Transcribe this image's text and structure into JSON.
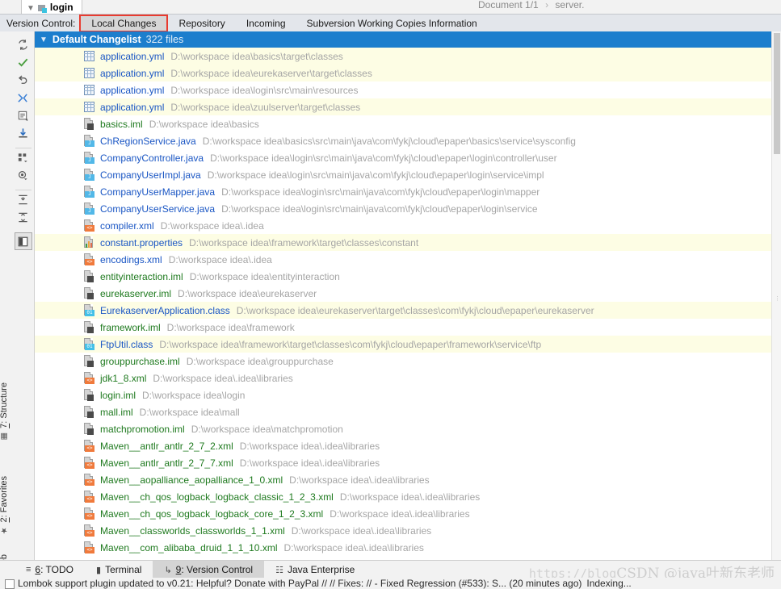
{
  "editor": {
    "tab_label": "login",
    "breadcrumb_document": "Document 1/1",
    "breadcrumb_sep": "›",
    "breadcrumb_node": "server."
  },
  "vcs_toolbar": {
    "label": "Version Control:",
    "tabs": [
      {
        "label": "Local Changes",
        "selected": true
      },
      {
        "label": "Repository",
        "selected": false
      },
      {
        "label": "Incoming",
        "selected": false
      },
      {
        "label": "Subversion Working Copies Information",
        "selected": false
      }
    ],
    "selected_outline_color": "#e83b2f"
  },
  "left_tool_labels": [
    {
      "label_prefix": "7",
      "label": ": Structure",
      "icon": "structure-icon"
    },
    {
      "label_prefix": "2",
      "label": ": Favorites",
      "icon": "star-icon"
    },
    {
      "label_prefix": "",
      "label": "Web",
      "icon": "globe-icon"
    }
  ],
  "action_buttons": [
    {
      "name": "refresh-icon",
      "tooltip": "Refresh"
    },
    {
      "name": "commit-checkmark-icon",
      "tooltip": "Commit"
    },
    {
      "name": "revert-arrow-icon",
      "tooltip": "Revert"
    },
    {
      "name": "collapse-arrows-icon",
      "tooltip": "Shelve Silently"
    },
    {
      "name": "changelist-notes-icon",
      "tooltip": "Edit Changelist"
    },
    {
      "name": "download-update-icon",
      "tooltip": "Update"
    },
    {
      "name": "group-by-icon",
      "tooltip": "Group By"
    },
    {
      "name": "eye-preview-icon",
      "tooltip": "Preview Diff"
    },
    {
      "name": "expand-all-icon",
      "tooltip": "Expand All"
    },
    {
      "name": "collapse-all-icon",
      "tooltip": "Collapse All"
    },
    {
      "name": "toggle-panel-icon",
      "tooltip": "Show Diff Preview"
    }
  ],
  "changelist": {
    "name": "Default Changelist",
    "count_label": "322 files",
    "header_bg": "#1c7ecd",
    "expanded": true
  },
  "files": [
    {
      "name": "application.yml",
      "path": "D:\\workspace idea\\basics\\target\\classes",
      "icon": "yml-file-icon",
      "color": "#1a56c4",
      "alt": true
    },
    {
      "name": "application.yml",
      "path": "D:\\workspace idea\\eurekaserver\\target\\classes",
      "icon": "yml-file-icon",
      "color": "#1a56c4",
      "alt": true
    },
    {
      "name": "application.yml",
      "path": "D:\\workspace idea\\login\\src\\main\\resources",
      "icon": "yml-file-icon",
      "color": "#1a56c4",
      "alt": false
    },
    {
      "name": "application.yml",
      "path": "D:\\workspace idea\\zuulserver\\target\\classes",
      "icon": "yml-file-icon",
      "color": "#1a56c4",
      "alt": true
    },
    {
      "name": "basics.iml",
      "path": "D:\\workspace idea\\basics",
      "icon": "iml-file-icon",
      "color": "#1f7a1f",
      "alt": false
    },
    {
      "name": "ChRegionService.java",
      "path": "D:\\workspace idea\\basics\\src\\main\\java\\com\\fykj\\cloud\\epaper\\basics\\service\\sysconfig",
      "icon": "java-file-icon",
      "color": "#1a56c4",
      "alt": false
    },
    {
      "name": "CompanyController.java",
      "path": "D:\\workspace idea\\login\\src\\main\\java\\com\\fykj\\cloud\\epaper\\login\\controller\\user",
      "icon": "java-file-icon",
      "color": "#1a56c4",
      "alt": false
    },
    {
      "name": "CompanyUserImpl.java",
      "path": "D:\\workspace idea\\login\\src\\main\\java\\com\\fykj\\cloud\\epaper\\login\\service\\impl",
      "icon": "java-file-icon",
      "color": "#1a56c4",
      "alt": false
    },
    {
      "name": "CompanyUserMapper.java",
      "path": "D:\\workspace idea\\login\\src\\main\\java\\com\\fykj\\cloud\\epaper\\login\\mapper",
      "icon": "java-file-icon",
      "color": "#1a56c4",
      "alt": false
    },
    {
      "name": "CompanyUserService.java",
      "path": "D:\\workspace idea\\login\\src\\main\\java\\com\\fykj\\cloud\\epaper\\login\\service",
      "icon": "java-file-icon",
      "color": "#1a56c4",
      "alt": false
    },
    {
      "name": "compiler.xml",
      "path": "D:\\workspace idea\\.idea",
      "icon": "xml-file-icon",
      "color": "#1a56c4",
      "alt": false
    },
    {
      "name": "constant.properties",
      "path": "D:\\workspace idea\\framework\\target\\classes\\constant",
      "icon": "properties-file-icon",
      "color": "#1a56c4",
      "alt": true
    },
    {
      "name": "encodings.xml",
      "path": "D:\\workspace idea\\.idea",
      "icon": "xml-file-icon",
      "color": "#1a56c4",
      "alt": false
    },
    {
      "name": "entityinteraction.iml",
      "path": "D:\\workspace idea\\entityinteraction",
      "icon": "iml-file-icon",
      "color": "#1f7a1f",
      "alt": false
    },
    {
      "name": "eurekaserver.iml",
      "path": "D:\\workspace idea\\eurekaserver",
      "icon": "iml-file-icon",
      "color": "#1f7a1f",
      "alt": false
    },
    {
      "name": "EurekaserverApplication.class",
      "path": "D:\\workspace idea\\eurekaserver\\target\\classes\\com\\fykj\\cloud\\epaper\\eurekaserver",
      "icon": "class-file-icon",
      "color": "#1a56c4",
      "alt": true
    },
    {
      "name": "framework.iml",
      "path": "D:\\workspace idea\\framework",
      "icon": "iml-file-icon",
      "color": "#1f7a1f",
      "alt": false
    },
    {
      "name": "FtpUtil.class",
      "path": "D:\\workspace idea\\framework\\target\\classes\\com\\fykj\\cloud\\epaper\\framework\\service\\ftp",
      "icon": "class-file-icon",
      "color": "#1a56c4",
      "alt": true
    },
    {
      "name": "grouppurchase.iml",
      "path": "D:\\workspace idea\\grouppurchase",
      "icon": "iml-file-icon",
      "color": "#1f7a1f",
      "alt": false
    },
    {
      "name": "jdk1_8.xml",
      "path": "D:\\workspace idea\\.idea\\libraries",
      "icon": "xml-file-icon",
      "color": "#1f7a1f",
      "alt": false
    },
    {
      "name": "login.iml",
      "path": "D:\\workspace idea\\login",
      "icon": "iml-file-icon",
      "color": "#1f7a1f",
      "alt": false
    },
    {
      "name": "mall.iml",
      "path": "D:\\workspace idea\\mall",
      "icon": "iml-file-icon",
      "color": "#1f7a1f",
      "alt": false
    },
    {
      "name": "matchpromotion.iml",
      "path": "D:\\workspace idea\\matchpromotion",
      "icon": "iml-file-icon",
      "color": "#1f7a1f",
      "alt": false
    },
    {
      "name": "Maven__antlr_antlr_2_7_2.xml",
      "path": "D:\\workspace idea\\.idea\\libraries",
      "icon": "xml-file-icon",
      "color": "#1f7a1f",
      "alt": false
    },
    {
      "name": "Maven__antlr_antlr_2_7_7.xml",
      "path": "D:\\workspace idea\\.idea\\libraries",
      "icon": "xml-file-icon",
      "color": "#1f7a1f",
      "alt": false
    },
    {
      "name": "Maven__aopalliance_aopalliance_1_0.xml",
      "path": "D:\\workspace idea\\.idea\\libraries",
      "icon": "xml-file-icon",
      "color": "#1f7a1f",
      "alt": false
    },
    {
      "name": "Maven__ch_qos_logback_logback_classic_1_2_3.xml",
      "path": "D:\\workspace idea\\.idea\\libraries",
      "icon": "xml-file-icon",
      "color": "#1f7a1f",
      "alt": false
    },
    {
      "name": "Maven__ch_qos_logback_logback_core_1_2_3.xml",
      "path": "D:\\workspace idea\\.idea\\libraries",
      "icon": "xml-file-icon",
      "color": "#1f7a1f",
      "alt": false
    },
    {
      "name": "Maven__classworlds_classworlds_1_1.xml",
      "path": "D:\\workspace idea\\.idea\\libraries",
      "icon": "xml-file-icon",
      "color": "#1f7a1f",
      "alt": false
    },
    {
      "name": "Maven__com_alibaba_druid_1_1_10.xml",
      "path": "D:\\workspace idea\\.idea\\libraries",
      "icon": "xml-file-icon",
      "color": "#1f7a1f",
      "alt": false
    }
  ],
  "bottom_tool_windows": [
    {
      "num": "6",
      "label": ": TODO",
      "icon": "todo-list-icon",
      "active": false
    },
    {
      "num": "",
      "label": "Terminal",
      "icon": "terminal-icon",
      "active": false
    },
    {
      "num": "9",
      "label": ": Version Control",
      "icon": "vcs-branch-icon",
      "active": true
    },
    {
      "num": "",
      "label": "Java Enterprise",
      "icon": "java-enterprise-icon",
      "active": false
    }
  ],
  "status_bar": {
    "message": "Lombok support plugin updated to v0.21: Helpful? Donate with PayPal // // Fixes: // - Fixed Regression (#533): S... (20 minutes ago)",
    "indexing": "Indexing..."
  },
  "watermark": {
    "url": "https://blog",
    "brand": "CSDN @java叶新东老师"
  }
}
